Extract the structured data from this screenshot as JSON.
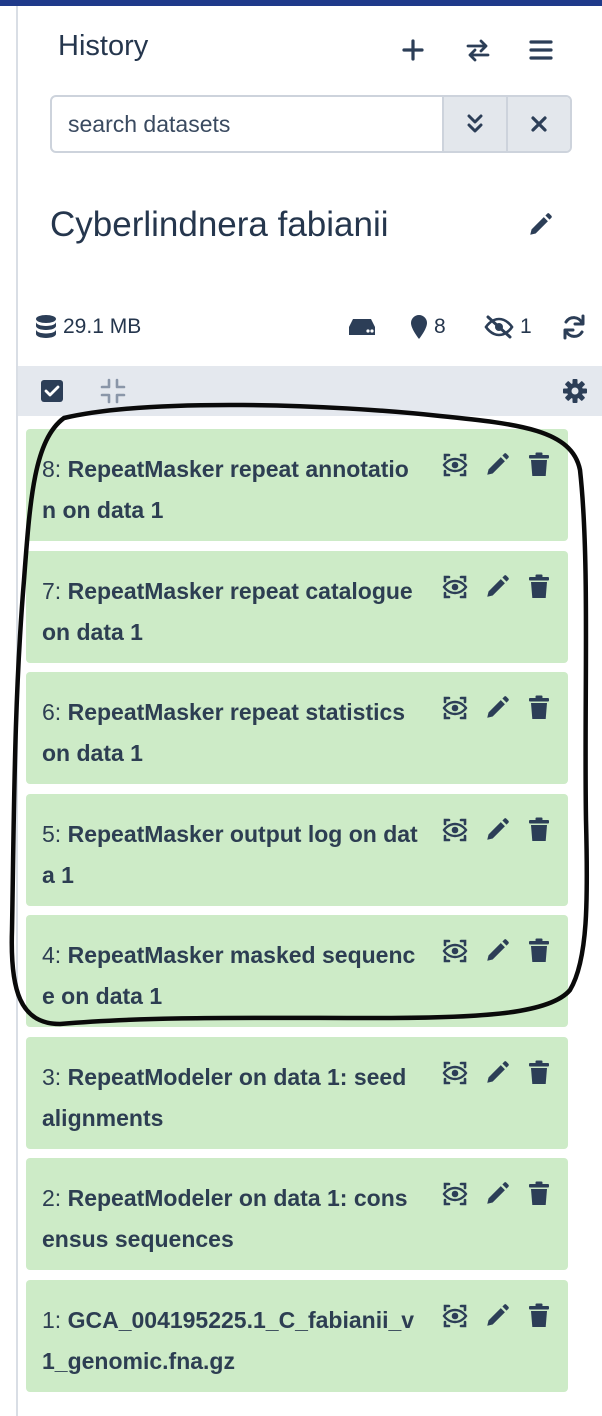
{
  "header": {
    "title": "History"
  },
  "search": {
    "placeholder": "search datasets"
  },
  "history": {
    "name": "Cyberlindnera fabianii"
  },
  "stats": {
    "size": "29.1 MB",
    "shown_count": "8",
    "hidden_count": "1"
  },
  "datasets": [
    {
      "hid": "8:",
      "name": "RepeatMasker repeat annotation on data 1"
    },
    {
      "hid": "7:",
      "name": "RepeatMasker repeat catalogue on data 1"
    },
    {
      "hid": "6:",
      "name": "RepeatMasker repeat statistics on data 1"
    },
    {
      "hid": "5:",
      "name": "RepeatMasker output log on data 1"
    },
    {
      "hid": "4:",
      "name": "RepeatMasker masked sequence on data 1"
    },
    {
      "hid": "3:",
      "name": "RepeatModeler on data 1: seed alignments"
    },
    {
      "hid": "2:",
      "name": "RepeatModeler on data 1: consensus sequences"
    },
    {
      "hid": "1:",
      "name": "GCA_004195225.1_C_fabianii_v1_genomic.fna.gz"
    }
  ],
  "colors": {
    "dataset_ok_bg": "#cdebc7",
    "icon": "#2c3e57",
    "top_bar": "#1f3a8a"
  },
  "icons": [
    "plus-icon",
    "switch-icon",
    "menu-icon",
    "chevrons-down-icon",
    "close-icon",
    "pencil-icon",
    "database-icon",
    "hard-drive-icon",
    "map-marker-icon",
    "eye-slash-icon",
    "refresh-icon",
    "checkbox-icon",
    "collapse-icon",
    "gear-icon",
    "eye-icon",
    "trash-icon"
  ]
}
